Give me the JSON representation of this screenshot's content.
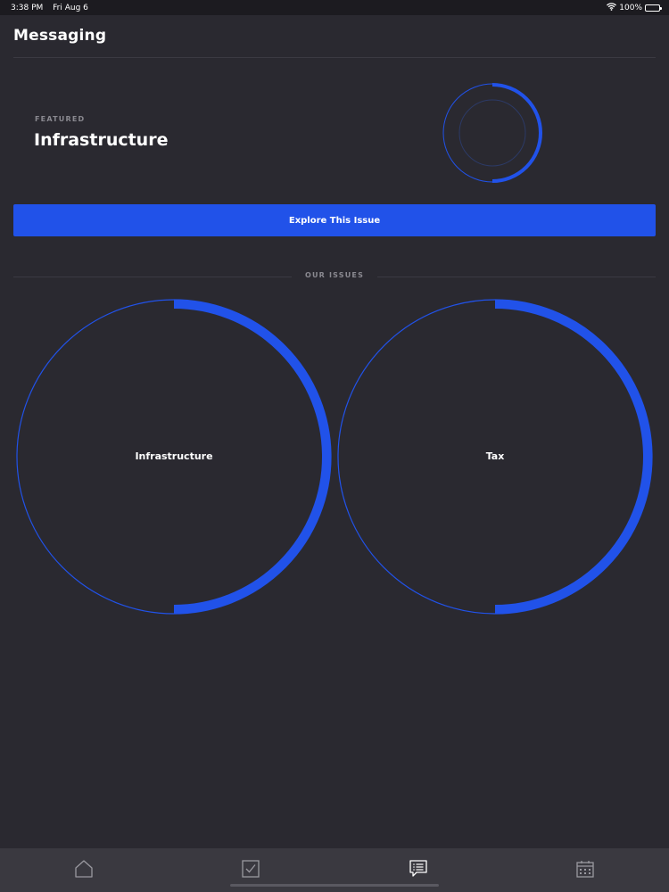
{
  "status_bar": {
    "time": "3:38 PM",
    "date": "Fri Aug 6",
    "battery": "100%"
  },
  "header": {
    "title": "Messaging"
  },
  "featured": {
    "label": "FEATURED",
    "title": "Infrastructure",
    "progress": 0.5
  },
  "explore_button": {
    "label": "Explore This Issue"
  },
  "issues_section": {
    "title": "OUR ISSUES"
  },
  "issues": [
    {
      "label": "Infrastructure",
      "progress": 0.5
    },
    {
      "label": "Tax",
      "progress": 0.5
    }
  ],
  "tab_bar": {
    "tabs": [
      {
        "icon": "home-icon",
        "active": false
      },
      {
        "icon": "checkbox-icon",
        "active": false
      },
      {
        "icon": "message-icon",
        "active": true
      },
      {
        "icon": "calendar-icon",
        "active": false
      }
    ]
  },
  "colors": {
    "background": "#2a2930",
    "accent": "#2152e9",
    "tab_bar": "#3a3940",
    "muted_text": "#8a8990"
  }
}
